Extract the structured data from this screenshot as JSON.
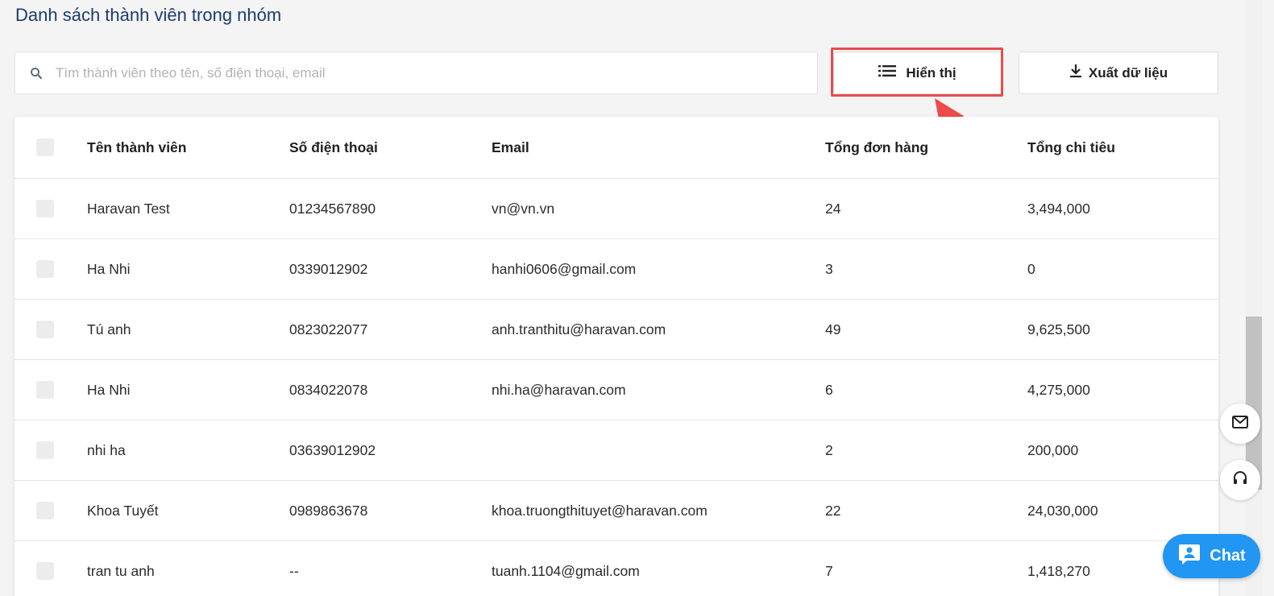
{
  "page": {
    "title": "Danh sách thành viên trong nhóm"
  },
  "search": {
    "placeholder": "Tìm thành viên theo tên, số điện thoại, email",
    "value": ""
  },
  "toolbar": {
    "display_label": "Hiển thị",
    "export_label": "Xuất dữ liệu"
  },
  "table": {
    "headers": {
      "name": "Tên thành viên",
      "phone": "Số điện thoại",
      "email": "Email",
      "orders": "Tổng đơn hàng",
      "spend": "Tổng chi tiêu"
    },
    "rows": [
      {
        "name": "Haravan Test",
        "phone": "01234567890",
        "email": "vn@vn.vn",
        "orders": "24",
        "spend": "3,494,000"
      },
      {
        "name": "Ha Nhi",
        "phone": "0339012902",
        "email": "hanhi0606@gmail.com",
        "orders": "3",
        "spend": "0"
      },
      {
        "name": "Tú anh",
        "phone": "0823022077",
        "email": "anh.tranthitu@haravan.com",
        "orders": "49",
        "spend": "9,625,500"
      },
      {
        "name": "Ha Nhi",
        "phone": "0834022078",
        "email": "nhi.ha@haravan.com",
        "orders": "6",
        "spend": "4,275,000"
      },
      {
        "name": "nhi ha",
        "phone": "03639012902",
        "email": "",
        "orders": "2",
        "spend": "200,000"
      },
      {
        "name": "Khoa Tuyết",
        "phone": "0989863678",
        "email": "khoa.truongthituyet@haravan.com",
        "orders": "22",
        "spend": "24,030,000"
      },
      {
        "name": "tran tu anh",
        "phone": "--",
        "email": "tuanh.1104@gmail.com",
        "orders": "7",
        "spend": "1,418,270"
      }
    ]
  },
  "chat": {
    "label": "Chat"
  },
  "icons": {
    "search": "search-icon",
    "list": "list-icon",
    "download": "download-icon",
    "mail": "mail-icon",
    "headset": "headset-icon",
    "chat": "chat-icon"
  },
  "colors": {
    "title": "#1e3a6d",
    "highlight": "#e74c4c",
    "chat": "#2196f3"
  }
}
